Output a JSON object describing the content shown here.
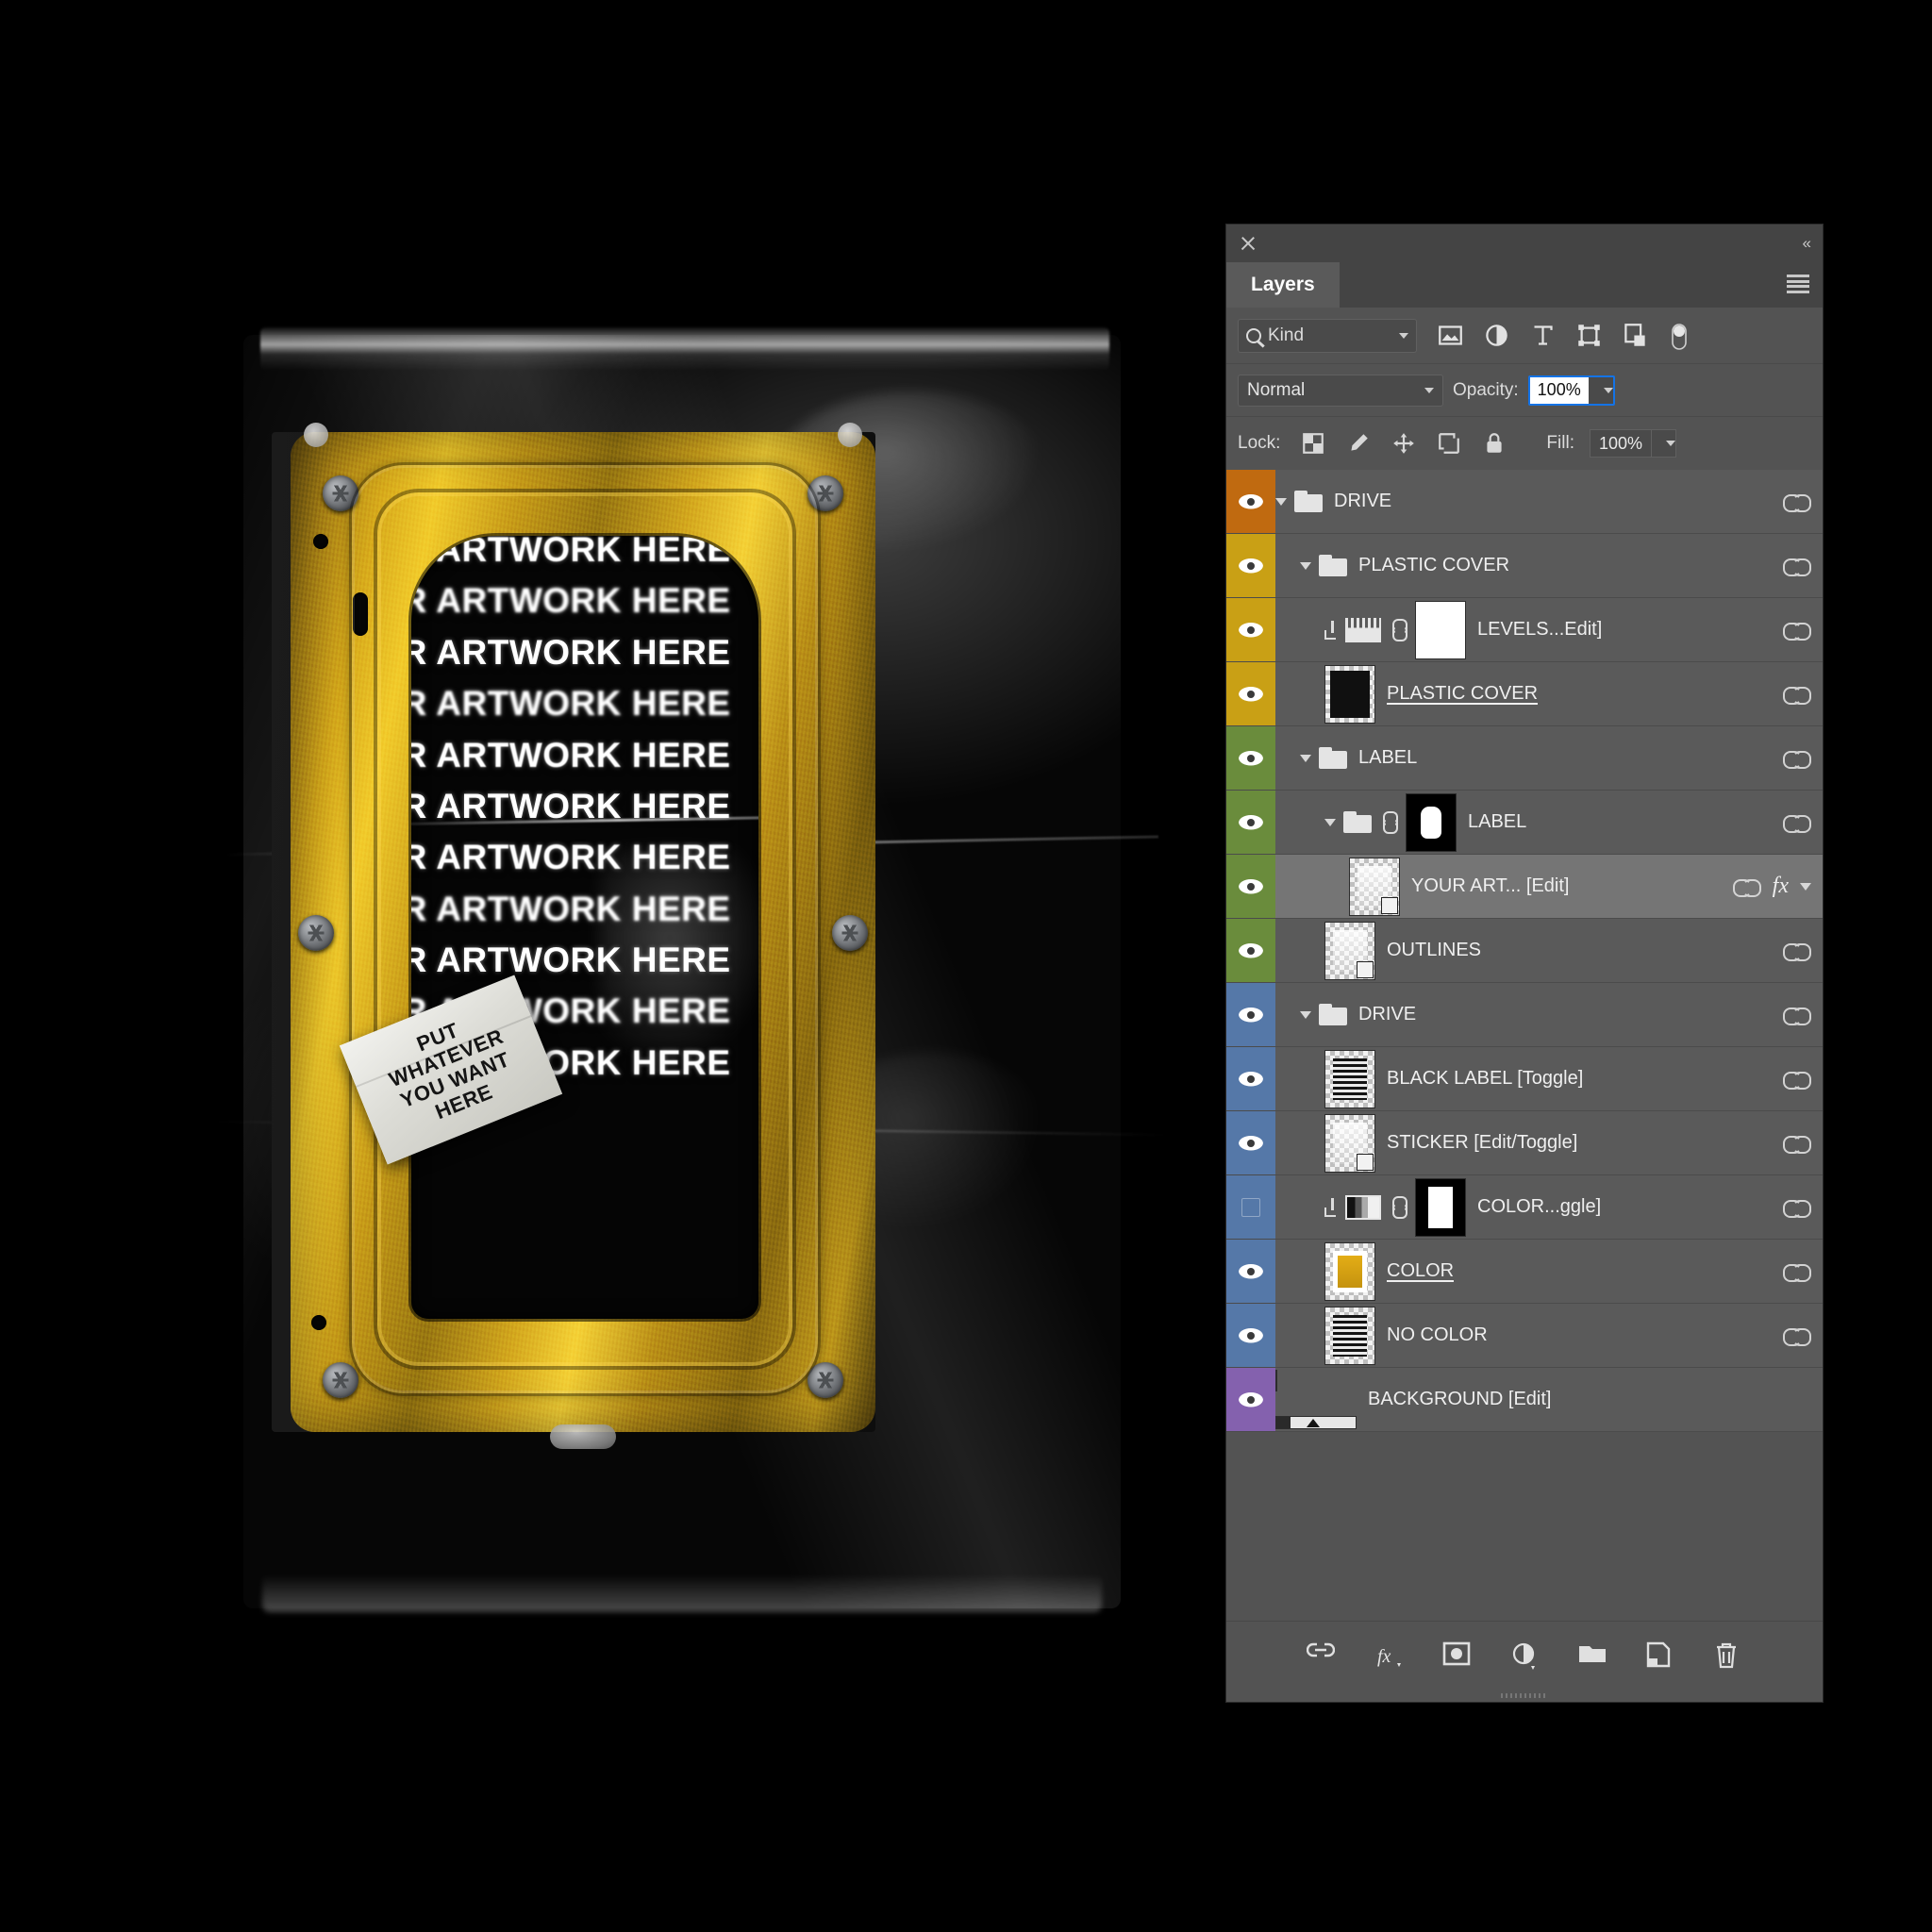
{
  "artwork": {
    "repeat_text": "YOUR ARTWORK HERE",
    "lines": [
      "YOUR ARTWORK HERE",
      "YOUR ARTWORK HERE",
      "YOUR ARTWORK HERE",
      "YOUR ARTWORK HERE",
      "YOUR ARTWORK HERE",
      "YOUR ARTWORK HERE",
      "YOUR ARTWORK HERE",
      "YOUR ARTWORK HERE",
      "YOUR ARTWORK HERE",
      "YOUR ARTWORK HERE",
      "YOUR ARTWORK HERE"
    ],
    "sticker": {
      "line1": "PUT",
      "line2": "WHATEVER",
      "line3": "YOU WANT",
      "line4": "HERE"
    }
  },
  "panel": {
    "close_icon": "close-icon",
    "collapse_icon": "collapse-icon",
    "tab_label": "Layers",
    "menu_icon": "panel-menu-icon",
    "filter": {
      "kind_label": "Kind",
      "search_icon": "search-icon",
      "icons": [
        "pixel-layer-filter-icon",
        "adjustment-layer-filter-icon",
        "type-layer-filter-icon",
        "shape-layer-filter-icon",
        "smart-object-filter-icon",
        "filter-toggle-switch"
      ]
    },
    "blend": {
      "mode": "Normal",
      "opacity_label": "Opacity:",
      "opacity_value": "100%"
    },
    "lock": {
      "label": "Lock:",
      "icons": [
        "lock-transparent-pixels-icon",
        "lock-image-pixels-icon",
        "lock-position-icon",
        "lock-artboard-icon",
        "lock-all-icon"
      ],
      "fill_label": "Fill:",
      "fill_value": "100%"
    },
    "footer_icons": [
      "link-layers-icon",
      "add-layer-style-icon",
      "add-layer-mask-icon",
      "new-adjustment-layer-icon",
      "new-group-icon",
      "new-layer-icon",
      "delete-layer-icon"
    ]
  },
  "colors": {
    "orange": "#c06a10",
    "yellow": "#c9a015",
    "green": "#6a8c3c",
    "blue": "#5578a8",
    "purple": "#8461ae",
    "accent_blue": "#1473e6",
    "panel_bg": "#535353",
    "row_bg": "#5a5a5a",
    "row_selected": "#757575"
  },
  "layers": [
    {
      "name": "DRIVE",
      "color": "orange",
      "visible": true,
      "type": "group",
      "indent": 0,
      "expanded": true,
      "linked": true,
      "selected": false,
      "underline": false
    },
    {
      "name": "PLASTIC COVER",
      "color": "yellow",
      "visible": true,
      "type": "group",
      "indent": 1,
      "expanded": true,
      "linked": true,
      "selected": false,
      "underline": false
    },
    {
      "name": "LEVELS...Edit]",
      "color": "yellow",
      "visible": true,
      "type": "adjustment-levels",
      "indent": 2,
      "clipped": true,
      "masklinked": true,
      "mask": "white",
      "linked": true,
      "selected": false,
      "underline": false
    },
    {
      "name": "PLASTIC COVER ",
      "color": "yellow",
      "visible": true,
      "type": "pixel",
      "indent": 2,
      "linked": true,
      "selected": false,
      "underline": true
    },
    {
      "name": "LABEL",
      "color": "green",
      "visible": true,
      "type": "group",
      "indent": 1,
      "expanded": true,
      "linked": true,
      "selected": false,
      "underline": false
    },
    {
      "name": "LABEL",
      "color": "green",
      "visible": true,
      "type": "group-masked",
      "indent": 2,
      "expanded": true,
      "masklinked": true,
      "mask": "blob",
      "linked": true,
      "selected": false,
      "underline": false
    },
    {
      "name": "YOUR ART... [Edit]",
      "color": "green",
      "visible": true,
      "type": "smart-object",
      "indent": 3,
      "linked": true,
      "fx": true,
      "selected": true,
      "underline": false
    },
    {
      "name": "OUTLINES",
      "color": "green",
      "visible": true,
      "type": "smart-object",
      "indent": 2,
      "linked": true,
      "selected": false,
      "underline": false
    },
    {
      "name": "DRIVE",
      "color": "blue",
      "visible": true,
      "type": "group",
      "indent": 1,
      "expanded": true,
      "linked": true,
      "selected": false,
      "underline": false
    },
    {
      "name": "BLACK LABEL [Toggle]",
      "color": "blue",
      "visible": true,
      "type": "pixel",
      "indent": 2,
      "linked": true,
      "selected": false,
      "underline": false
    },
    {
      "name": "STICKER [Edit/Toggle]",
      "color": "blue",
      "visible": true,
      "type": "smart-object",
      "indent": 2,
      "linked": true,
      "selected": false,
      "underline": false
    },
    {
      "name": "COLOR...ggle]",
      "color": "blue",
      "visible": false,
      "type": "adjustment-gradient",
      "indent": 2,
      "clipped": true,
      "masklinked": true,
      "mask": "rect",
      "linked": true,
      "selected": false,
      "underline": false
    },
    {
      "name": "COLOR",
      "color": "blue",
      "visible": true,
      "type": "pixel-color",
      "indent": 2,
      "linked": true,
      "selected": false,
      "underline": true
    },
    {
      "name": "NO COLOR",
      "color": "blue",
      "visible": true,
      "type": "pixel",
      "indent": 2,
      "linked": true,
      "selected": false,
      "underline": false
    },
    {
      "name": "BACKGROUND [Edit]",
      "color": "purple",
      "visible": true,
      "type": "background",
      "indent": 0,
      "linked": false,
      "selected": false,
      "underline": false
    }
  ]
}
